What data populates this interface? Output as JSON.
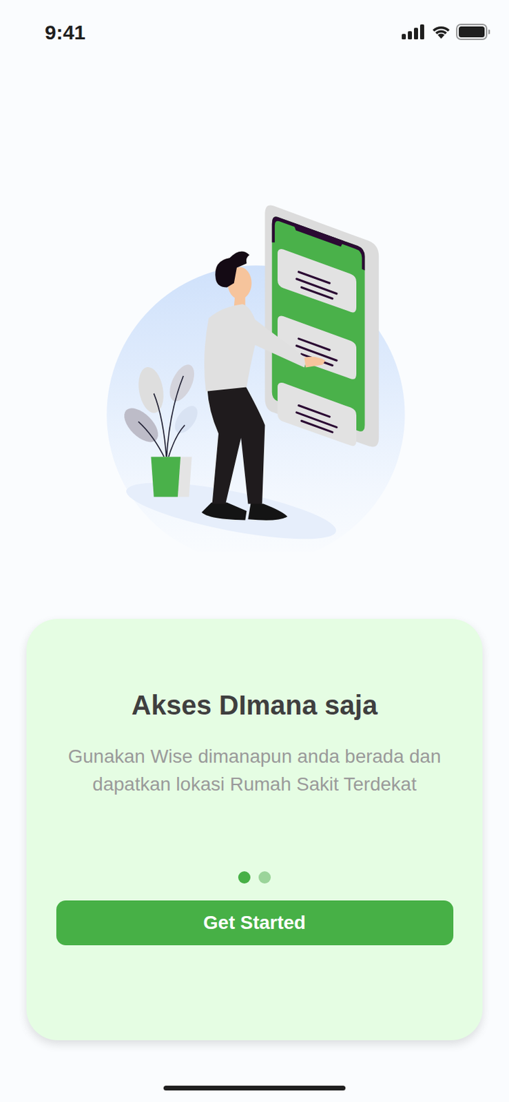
{
  "status_bar": {
    "time": "9:41"
  },
  "onboarding": {
    "title": "Akses DImana saja",
    "description": "Gunakan Wise dimanapun anda berada dan dapatkan lokasi Rumah Sakit Terdekat"
  },
  "pager_dots": [
    {
      "selected": true
    },
    {
      "selected": false
    }
  ],
  "buttons": [
    "Get Started"
  ]
}
